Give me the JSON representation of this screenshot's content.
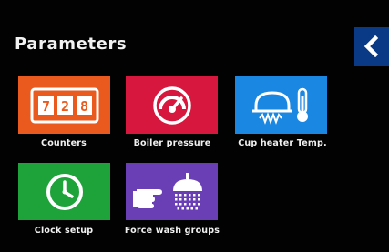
{
  "header": {
    "title": "Parameters"
  },
  "back_button": {
    "icon": "chevron-left-icon"
  },
  "colors": {
    "counters": "#ea5a1e",
    "boiler": "#d7173d",
    "cup": "#1a87e2",
    "clock": "#1ea23a",
    "wash": "#6a3fb6",
    "back": "#0a3a86"
  },
  "tiles": {
    "counters": {
      "label": "Counters",
      "icon": "counter-display-icon",
      "digits": [
        "7",
        "2",
        "8"
      ]
    },
    "boiler": {
      "label": "Boiler pressure",
      "icon": "pressure-gauge-icon"
    },
    "cup": {
      "label": "Cup heater Temp.",
      "icon": "cup-heater-thermometer-icon"
    },
    "clock": {
      "label": "Clock setup",
      "icon": "clock-icon"
    },
    "wash": {
      "label": "Force wash groups",
      "icon": "hand-shower-icon"
    }
  }
}
